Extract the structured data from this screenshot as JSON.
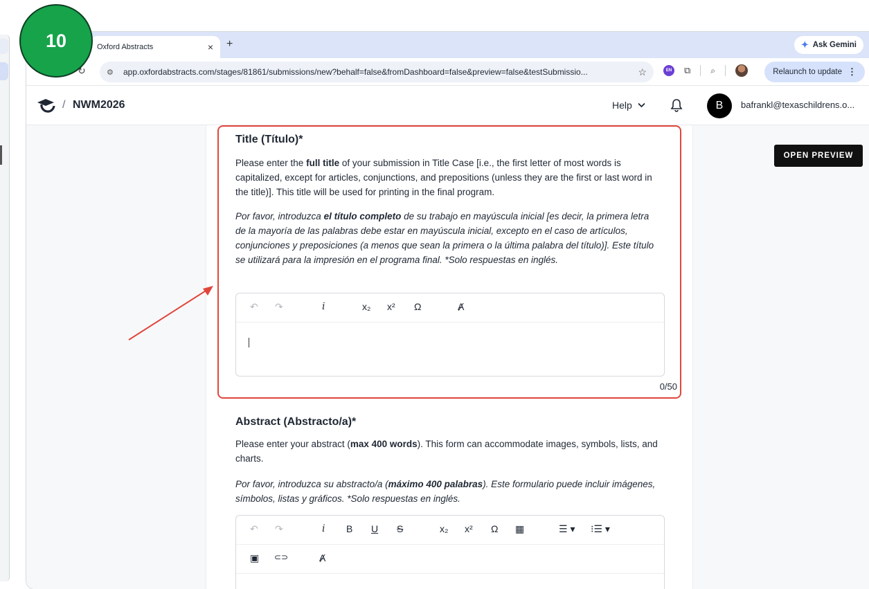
{
  "step_badge": "10",
  "browser": {
    "tab_title": "Oxford Abstracts",
    "tab_close": "×",
    "new_tab": "+",
    "ask_gemini": "Ask Gemini",
    "url": "app.oxfordabstracts.com/stages/81861/submissions/new?behalf=false&fromDashboard=false&preview=false&testSubmissio...",
    "extension_badge": "EN",
    "relaunch_label": "Relaunch to update"
  },
  "header": {
    "separator": "/",
    "conference_name": "NWM2026",
    "help_label": "Help",
    "avatar_initial": "B",
    "user_email": "bafrankl@texaschildrens.o..."
  },
  "actions": {
    "open_preview": "OPEN PREVIEW"
  },
  "title_field": {
    "heading": "Title (Título)*",
    "desc_en_1": "Please enter the ",
    "desc_en_bold": "full title",
    "desc_en_2": " of your submission in Title Case [i.e., the first letter of most words is capitalized, except for articles, conjunctions, and prepositions (unless they are the first or last word in the title)]. This title will be used for printing in the final program.",
    "desc_es_1": "Por favor, introduzca ",
    "desc_es_bold": "el título completo",
    "desc_es_2": " de su trabajo en mayúscula inicial [es decir, la primera letra de la mayoría de las palabras debe estar en mayúscula inicial, excepto en el caso de artículos, conjunciones y preposiciones (a menos que sean la primera o la última palabra del título)]. Este título se utilizará para la impresión en el programa final. *Solo respuestas en inglés.",
    "counter": "0/50"
  },
  "abstract_field": {
    "heading": "Abstract (Abstracto/a)*",
    "desc_en_1": "Please enter your abstract (",
    "desc_en_bold": "max 400 words",
    "desc_en_2": "). This form can accommodate images, symbols, lists, and charts.",
    "desc_es_1": "Por favor, introduzca su abstracto/a (",
    "desc_es_bold": "máximo 400 palabras",
    "desc_es_2": "). Este formulario puede incluir imágenes, símbolos, listas y gráficos. *Solo respuestas en inglés."
  },
  "toolbar_glyphs": {
    "undo": "↶",
    "redo": "↷",
    "italic": "i",
    "bold": "B",
    "underline": "U",
    "strike": "S",
    "subscript": "x₂",
    "superscript": "x²",
    "omega": "Ω",
    "table": "▦",
    "bullet_list": "☰ ▾",
    "numbered_list": "⁝☰ ▾",
    "image": "▣",
    "link": "⊂⊃",
    "clear_format": "Ⱥ"
  },
  "colors": {
    "highlight": "#e0463c",
    "badge": "#16a34a",
    "tab_strip": "#dbe4f8"
  }
}
